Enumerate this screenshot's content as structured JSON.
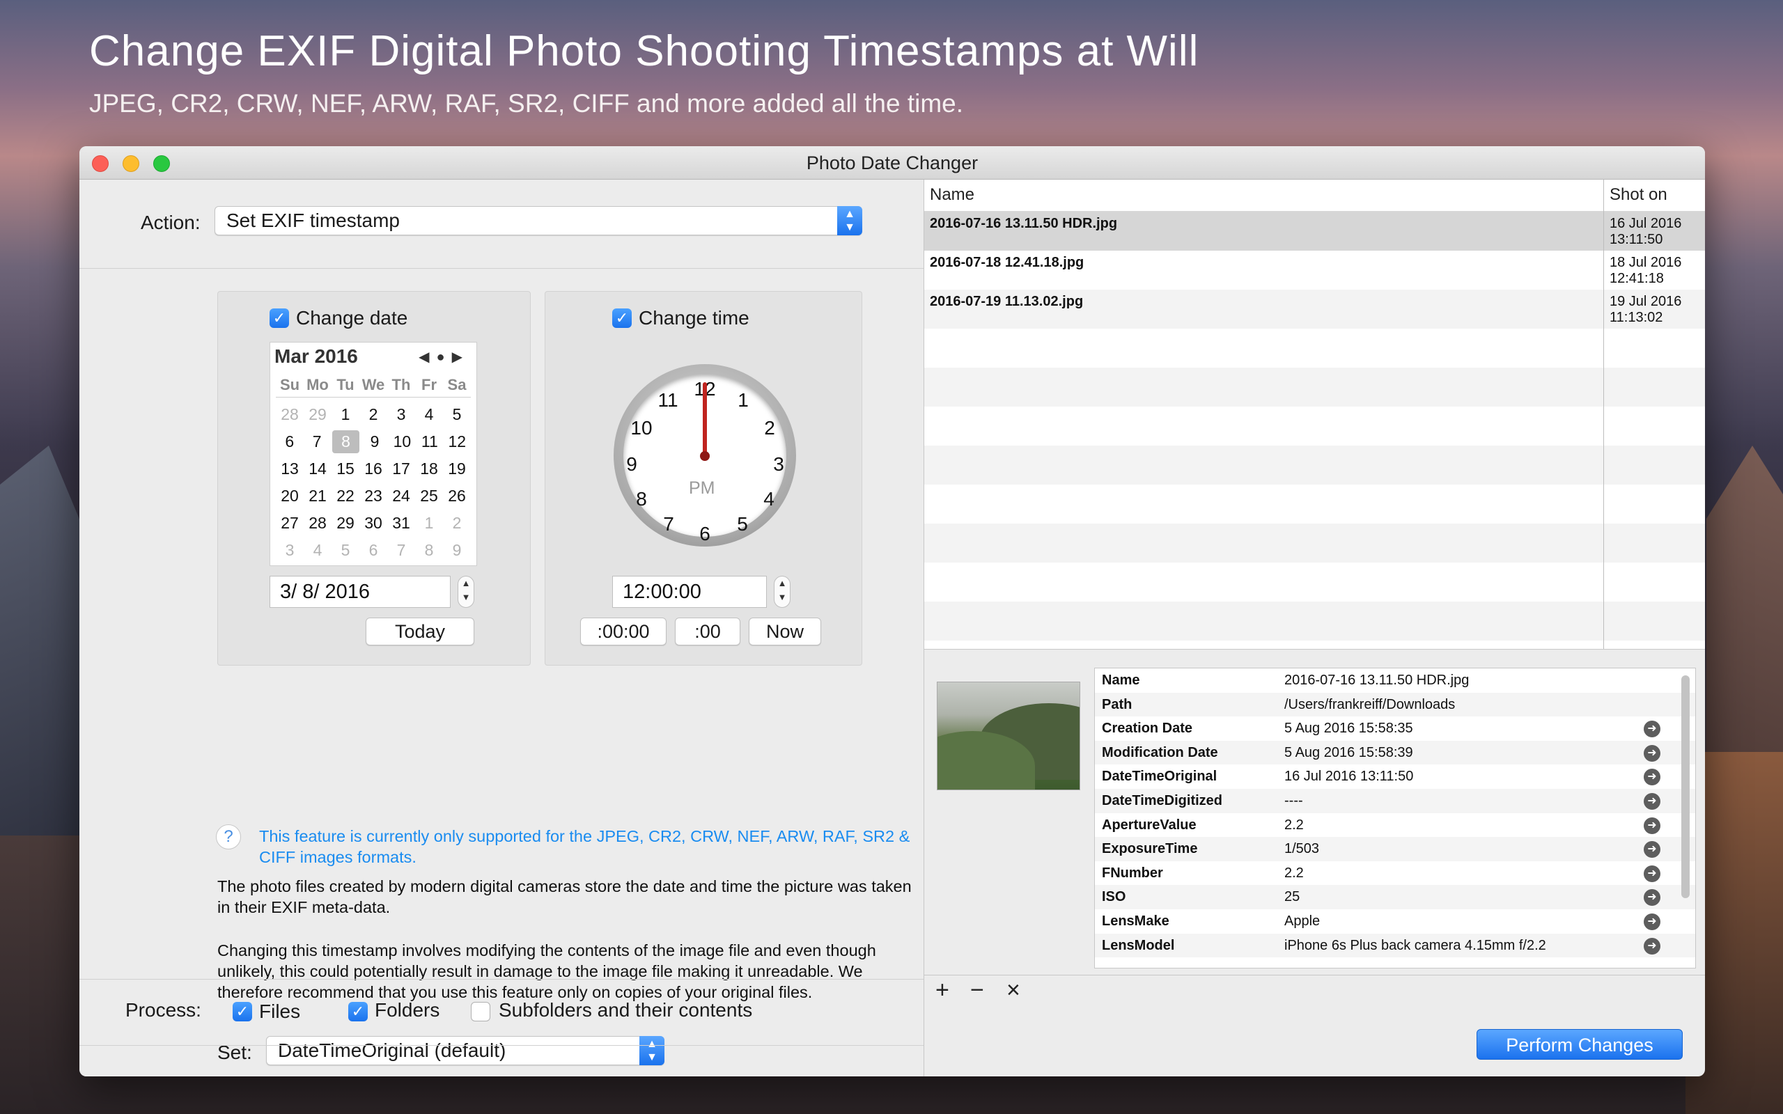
{
  "hero": {
    "title": "Change EXIF Digital Photo Shooting Timestamps at Will",
    "subtitle": "JPEG, CR2, CRW, NEF, ARW, RAF, SR2, CIFF and more added all the time."
  },
  "window": {
    "title": "Photo Date Changer"
  },
  "action": {
    "label": "Action:",
    "value": "Set EXIF timestamp"
  },
  "date_panel": {
    "checkbox_label": "Change date",
    "month": "Mar 2016",
    "dow": [
      "Su",
      "Mo",
      "Tu",
      "We",
      "Th",
      "Fr",
      "Sa"
    ],
    "weeks": [
      [
        "28",
        "29",
        "1",
        "2",
        "3",
        "4",
        "5"
      ],
      [
        "6",
        "7",
        "8",
        "9",
        "10",
        "11",
        "12"
      ],
      [
        "13",
        "14",
        "15",
        "16",
        "17",
        "18",
        "19"
      ],
      [
        "20",
        "21",
        "22",
        "23",
        "24",
        "25",
        "26"
      ],
      [
        "27",
        "28",
        "29",
        "30",
        "31",
        "1",
        "2"
      ],
      [
        "3",
        "4",
        "5",
        "6",
        "7",
        "8",
        "9"
      ]
    ],
    "date_value": "3/  8/ 2016",
    "today_label": "Today"
  },
  "time_panel": {
    "checkbox_label": "Change time",
    "clock_numbers": [
      "12",
      "1",
      "2",
      "3",
      "4",
      "5",
      "6",
      "7",
      "8",
      "9",
      "10",
      "11"
    ],
    "ampm": "PM",
    "time_value": "12:00:00",
    "btn_min": ":00:00",
    "btn_sec": ":00",
    "btn_now": "Now"
  },
  "info": {
    "notice": "This feature is currently only supported for the JPEG, CR2, CRW, NEF, ARW, RAF, SR2 & CIFF images formats.",
    "para1": "The photo files created by modern digital cameras store the date and time the picture was taken in their EXIF meta-data.",
    "para2": "Changing this timestamp involves modifying the contents of the image file and even though unlikely, this could potentially result in damage to the image file making it unreadable. We therefore recommend that you use this feature only on copies of your original files."
  },
  "set": {
    "label": "Set:",
    "value": "DateTimeOriginal (default)"
  },
  "process": {
    "label": "Process:",
    "files": "Files",
    "folders": "Folders",
    "subfolders": "Subfolders and their contents"
  },
  "table": {
    "col_name": "Name",
    "col_shot": "Shot on",
    "rows": [
      {
        "name": "2016-07-16 13.11.50 HDR.jpg",
        "date": "16 Jul 2016",
        "time": "13:11:50"
      },
      {
        "name": "2016-07-18 12.41.18.jpg",
        "date": "18 Jul 2016",
        "time": "12:41:18"
      },
      {
        "name": "2016-07-19 11.13.02.jpg",
        "date": "19 Jul 2016",
        "time": "11:13:02"
      }
    ]
  },
  "properties": [
    {
      "key": "Name",
      "value": "2016-07-16 13.11.50 HDR.jpg",
      "arrow": false
    },
    {
      "key": "Path",
      "value": "/Users/frankreiff/Downloads",
      "arrow": false
    },
    {
      "key": "Creation Date",
      "value": "5 Aug 2016 15:58:35",
      "arrow": true
    },
    {
      "key": "Modification Date",
      "value": "5 Aug 2016 15:58:39",
      "arrow": true
    },
    {
      "key": "DateTimeOriginal",
      "value": "16 Jul 2016 13:11:50",
      "arrow": true
    },
    {
      "key": "DateTimeDigitized",
      "value": "----",
      "arrow": true
    },
    {
      "key": "ApertureValue",
      "value": "2.2",
      "arrow": true
    },
    {
      "key": "ExposureTime",
      "value": "1/503",
      "arrow": true
    },
    {
      "key": "FNumber",
      "value": "2.2",
      "arrow": true
    },
    {
      "key": "ISO",
      "value": "25",
      "arrow": true
    },
    {
      "key": "LensMake",
      "value": "Apple",
      "arrow": true
    },
    {
      "key": "LensModel",
      "value": "iPhone 6s Plus back camera 4.15mm f/2.2",
      "arrow": true
    }
  ],
  "tools": {
    "add": "+",
    "remove": "−",
    "clear": "×"
  },
  "perform_label": "Perform Changes",
  "colors": {
    "accent": "#1a72ed",
    "notice": "#1a8cf0"
  }
}
